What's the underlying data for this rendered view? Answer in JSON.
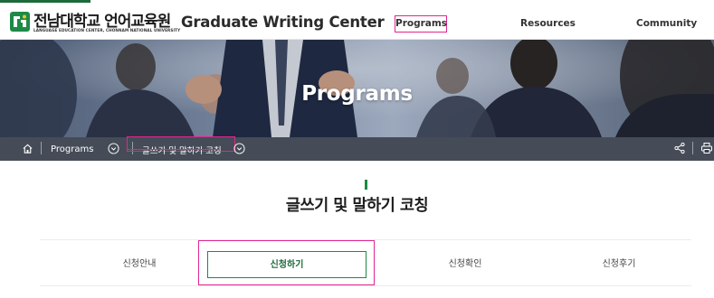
{
  "header": {
    "logo_korean": "전남대학교 언어교육원",
    "logo_english": "LANGUAGE EDUCATION CENTER, CHONNAM NATIONAL UNIVERSITY",
    "site_title": "Graduate Writing Center",
    "nav": [
      {
        "label": "Programs"
      },
      {
        "label": "Resources"
      },
      {
        "label": "Community"
      }
    ]
  },
  "hero": {
    "title": "Programs"
  },
  "breadcrumb": {
    "home_icon": "home-icon",
    "level1": "Programs",
    "current": "글쓰기 및 말하기 코칭"
  },
  "content": {
    "heading": "글쓰기 및 말하기 코칭",
    "tabs": [
      {
        "label": "신청안내"
      },
      {
        "label": "신청하기"
      },
      {
        "label": "신청확인"
      },
      {
        "label": "신청후기"
      }
    ]
  },
  "colors": {
    "brand_green": "#1d8a46",
    "highlight_magenta": "#e0268f",
    "breadcrumb_bg": "#373e4a"
  }
}
